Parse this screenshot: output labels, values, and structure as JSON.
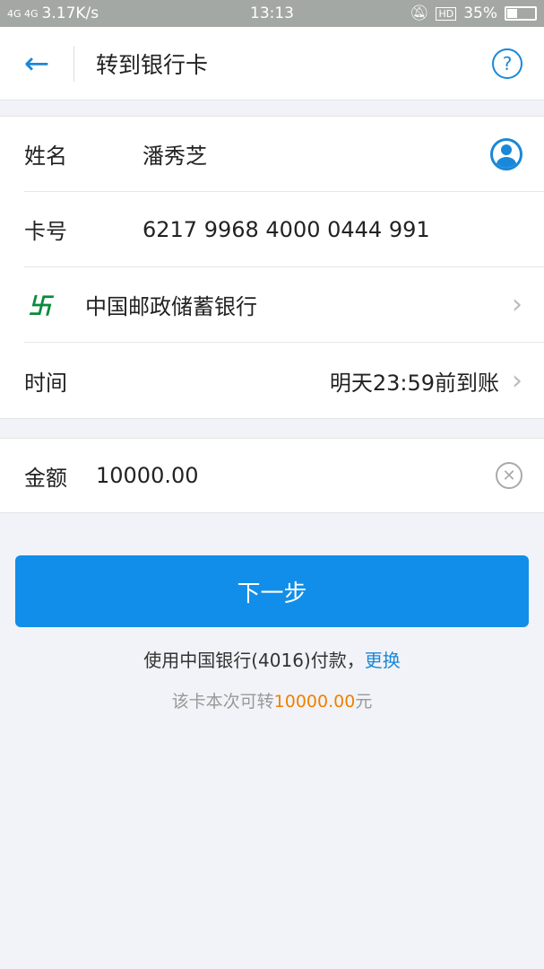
{
  "status_bar": {
    "network": "4G 4G",
    "speed": "3.17K/s",
    "time": "13:13",
    "hd": "HD",
    "battery": "35%",
    "battery_level": 0.35
  },
  "nav": {
    "back_icon": "arrow-left-icon",
    "title": "转到银行卡",
    "help_icon": "question-circle-icon",
    "help_glyph": "?"
  },
  "form": {
    "name_label": "姓名",
    "name_value": "潘秀芝",
    "card_label": "卡号",
    "card_value": "6217 9968 4000 0444 991",
    "bank_name": "中国邮政储蓄银行",
    "time_label": "时间",
    "time_value": "明天23:59前到账",
    "amount_label": "金额",
    "amount_value": "10000.00"
  },
  "next_button": "下一步",
  "payment": {
    "text": "使用中国银行(4016)付款，",
    "change_link": "更换"
  },
  "limit": {
    "prefix": "该卡本次可转",
    "amount": "10000.00",
    "suffix": "元"
  },
  "colors": {
    "accent": "#108ee9",
    "highlight": "#f08000",
    "bank_green": "#0b8a3c"
  }
}
